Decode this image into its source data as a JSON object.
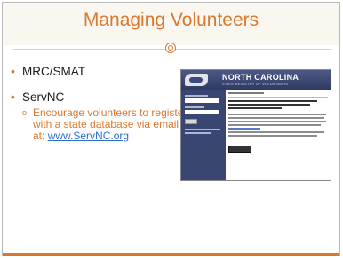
{
  "slide": {
    "title": "Managing Volunteers",
    "bullets": [
      {
        "text": "MRC/SMAT"
      },
      {
        "text": "ServNC"
      }
    ],
    "sub_bullet": {
      "text": "Encourage volunteers to register with a state database via email at: ",
      "link_text": "www.ServNC.org"
    }
  },
  "screenshot": {
    "banner_title": "NORTH CAROLINA",
    "banner_subtitle": "STATE REGISTRY OF VOLUNTEERS"
  },
  "colors": {
    "accent": "#d9782f",
    "link": "#2c6fcf",
    "banner": "#3a4672"
  }
}
